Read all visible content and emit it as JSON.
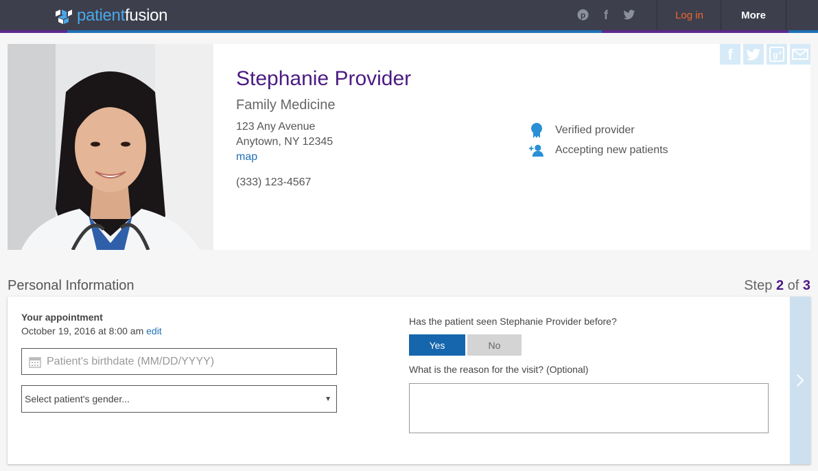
{
  "brand": {
    "part1": "patient",
    "part2": "fusion"
  },
  "nav": {
    "login": "Log in",
    "more": "More"
  },
  "top_social_icons": [
    "pinterest-icon",
    "facebook-icon",
    "twitter-icon"
  ],
  "provider": {
    "name": "Stephanie Provider",
    "specialty": "Family Medicine",
    "address_line1": "123 Any Avenue",
    "address_line2": "Anytown, NY 12345",
    "map_label": "map",
    "phone": "(333) 123-4567",
    "badges": [
      "Verified provider",
      "Accepting new patients"
    ]
  },
  "share_icons": [
    "facebook-icon",
    "twitter-icon",
    "google-plus-icon",
    "email-icon"
  ],
  "section": {
    "title": "Personal Information",
    "step_prefix": "Step",
    "step_current": "2",
    "step_of": "of",
    "step_total": "3"
  },
  "appointment": {
    "label": "Your appointment",
    "datetime": "October 19, 2016 at 8:00 am",
    "edit": "edit"
  },
  "form": {
    "birthdate_placeholder": "Patient's birthdate (MM/DD/YYYY)",
    "gender_selected": "Select patient's gender...",
    "seen_before_question": "Has the patient seen Stephanie Provider before?",
    "yes": "Yes",
    "no": "No",
    "seen_before_value": "Yes",
    "reason_question": "What is the reason for the visit? (Optional)",
    "reason_value": ""
  },
  "colors": {
    "topbar": "#3d3f4d",
    "accent_blue": "#1f70b5",
    "accent_purple": "#4b1a82",
    "login": "#f0682c"
  }
}
